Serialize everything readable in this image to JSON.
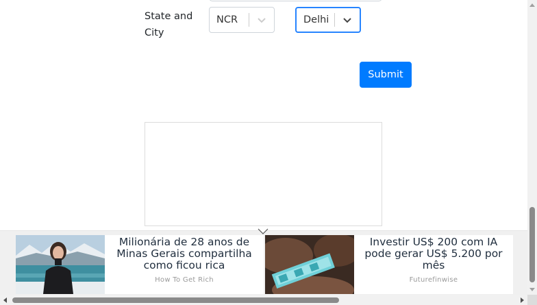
{
  "form": {
    "state_city_label": "State and City",
    "state_select": {
      "value": "NCR",
      "icon": "chevron-down-icon"
    },
    "city_select": {
      "value": "Delhi",
      "icon": "chevron-down-icon",
      "focused": true
    },
    "submit_label": "Submit"
  },
  "colors": {
    "primary": "#007bff",
    "focus_border": "#2684ff",
    "input_border": "#ced4da"
  },
  "ads": [
    {
      "headline": "Milionária de 28 anos de Minas Gerais compartilha como ficou rica",
      "source": "How To Get Rich"
    },
    {
      "headline": "Investir US$ 200 com IA pode gerar US$ 5.200 por mês",
      "source": "Futurefinwise"
    }
  ]
}
